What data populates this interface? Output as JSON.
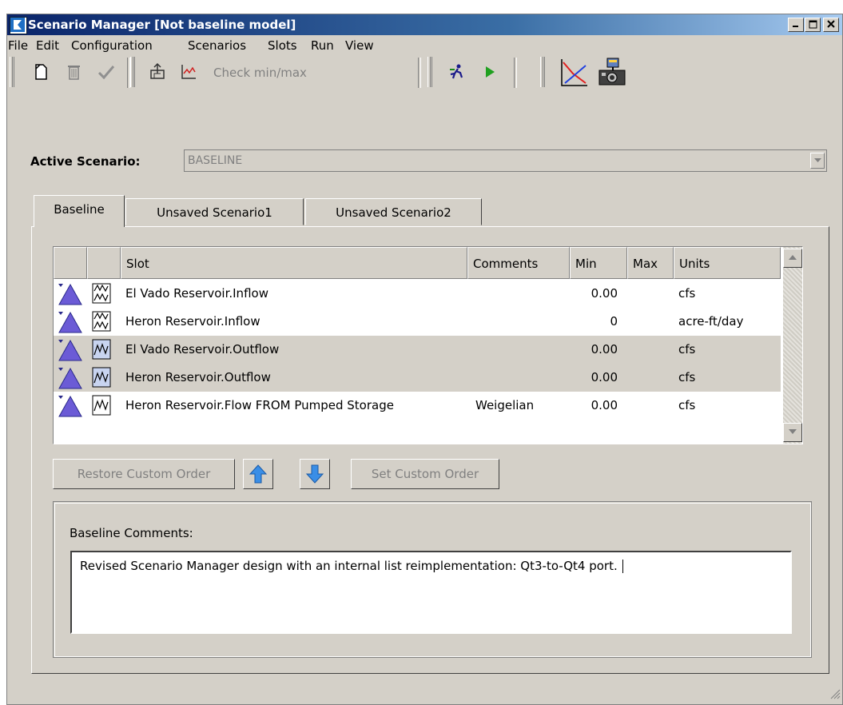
{
  "window": {
    "title": "Scenario Manager [Not baseline model]"
  },
  "menu": [
    "File",
    "Edit",
    "Configuration",
    "Scenarios",
    "Slots",
    "Run",
    "View"
  ],
  "toolbar": {
    "check_label": "Check min/max",
    "icons": [
      "new-icon",
      "delete-icon",
      "checkmark-icon",
      "export-icon",
      "plot-icon",
      "run-figure-icon",
      "run-play-icon",
      "chart-icon",
      "snapshot-icon"
    ]
  },
  "active_scenario": {
    "label": "Active Scenario:",
    "value": "BASELINE"
  },
  "tabs": [
    {
      "label": "Baseline",
      "active": true
    },
    {
      "label": "Unsaved Scenario1",
      "active": false
    },
    {
      "label": "Unsaved Scenario2",
      "active": false
    }
  ],
  "table": {
    "headers": [
      "",
      "",
      "Slot",
      "Comments",
      "Min",
      "Max",
      "Units"
    ],
    "rows": [
      {
        "slot": "El Vado Reservoir.Inflow",
        "comments": "",
        "min": "0.00",
        "max": "",
        "units": "cfs",
        "selected": false
      },
      {
        "slot": "Heron Reservoir.Inflow",
        "comments": "",
        "min": "0",
        "max": "",
        "units": "acre-ft/day",
        "selected": false
      },
      {
        "slot": "El Vado Reservoir.Outflow",
        "comments": "",
        "min": "0.00",
        "max": "",
        "units": "cfs",
        "selected": true
      },
      {
        "slot": "Heron Reservoir.Outflow",
        "comments": "",
        "min": "0.00",
        "max": "",
        "units": "cfs",
        "selected": true
      },
      {
        "slot": "Heron Reservoir.Flow FROM Pumped Storage",
        "comments": "Weigelian",
        "min": "0.00",
        "max": "",
        "units": "cfs",
        "selected": false
      }
    ]
  },
  "buttons": {
    "restore": "Restore Custom Order",
    "set": "Set Custom Order"
  },
  "comments": {
    "label": "Baseline Comments:",
    "text": "Revised Scenario Manager design with an internal list reimplementation: Qt3-to-Qt4 port."
  },
  "colors": {
    "title_start": "#0a246a",
    "title_end": "#a6caf0",
    "face": "#d4d0c8",
    "triangle": "#6b5bd6",
    "arrow": "#3a8ee6"
  }
}
